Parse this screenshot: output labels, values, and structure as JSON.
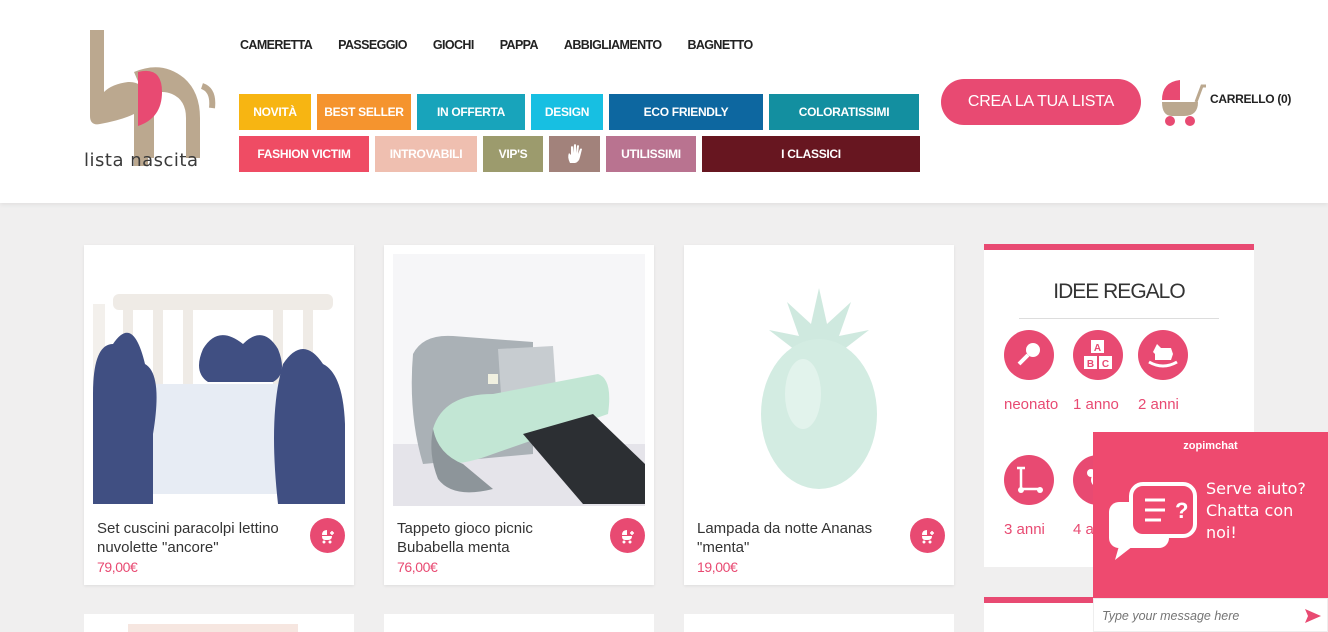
{
  "logo": {
    "text": "lista nascita",
    "colors": {
      "gray": "#bba88f",
      "pink": "#e84a72"
    }
  },
  "topnav": [
    "CAMERETTA",
    "PASSEGGIO",
    "GIOCHI",
    "PAPPA",
    "ABBIGLIAMENTO",
    "BAGNETTO"
  ],
  "tags": [
    {
      "label": "NOVITÀ",
      "color": "#f7b512"
    },
    {
      "label": "BEST SELLER",
      "color": "#f5942e"
    },
    {
      "label": "IN OFFERTA",
      "color": "#18a4bb"
    },
    {
      "label": "DESIGN",
      "color": "#17bfe2"
    },
    {
      "label": "ECO FRIENDLY",
      "color": "#0d67a0"
    },
    {
      "label": "COLORATISSIMI",
      "color": "#138fa0"
    },
    {
      "label": "FASHION VICTIM",
      "color": "#ef4c64"
    },
    {
      "label": "INTROVABILI",
      "color": "#efbfb0"
    },
    {
      "label": "VIP'S",
      "color": "#9c9b6d"
    },
    {
      "label": "",
      "icon": "hand-icon",
      "color": "#a2827b"
    },
    {
      "label": "UTILISSIMI",
      "color": "#b97390"
    },
    {
      "label": "I CLASSICI",
      "color": "#671620"
    }
  ],
  "cta": {
    "label": "CREA LA TUA LISTA",
    "color": "#e84a72"
  },
  "cart": {
    "label": "CARRELLO",
    "count": "(0)",
    "icon": "stroller-icon"
  },
  "products": [
    {
      "title": "Set cuscini paracolpi lettino nuvolette \"ancore\"",
      "price": "79,00€"
    },
    {
      "title": "Tappeto gioco picnic Bubabella menta",
      "price": "76,00€"
    },
    {
      "title": "Lampada da notte Ananas \"menta\"",
      "price": "19,00€"
    }
  ],
  "sidebar": {
    "title": "IDEE REGALO",
    "categories": [
      {
        "label": "neonato",
        "icon": "rattle-icon"
      },
      {
        "label": "1 anno",
        "icon": "abc-blocks-icon"
      },
      {
        "label": "2 anni",
        "icon": "rocking-horse-icon"
      },
      {
        "label": "3 anni",
        "icon": "scooter-icon"
      },
      {
        "label": "4 a",
        "icon": "toy-icon"
      }
    ]
  },
  "chat": {
    "brand": "zopimchat",
    "message": "Serve aiuto? Chatta con noi!",
    "placeholder": "Type your message here"
  }
}
